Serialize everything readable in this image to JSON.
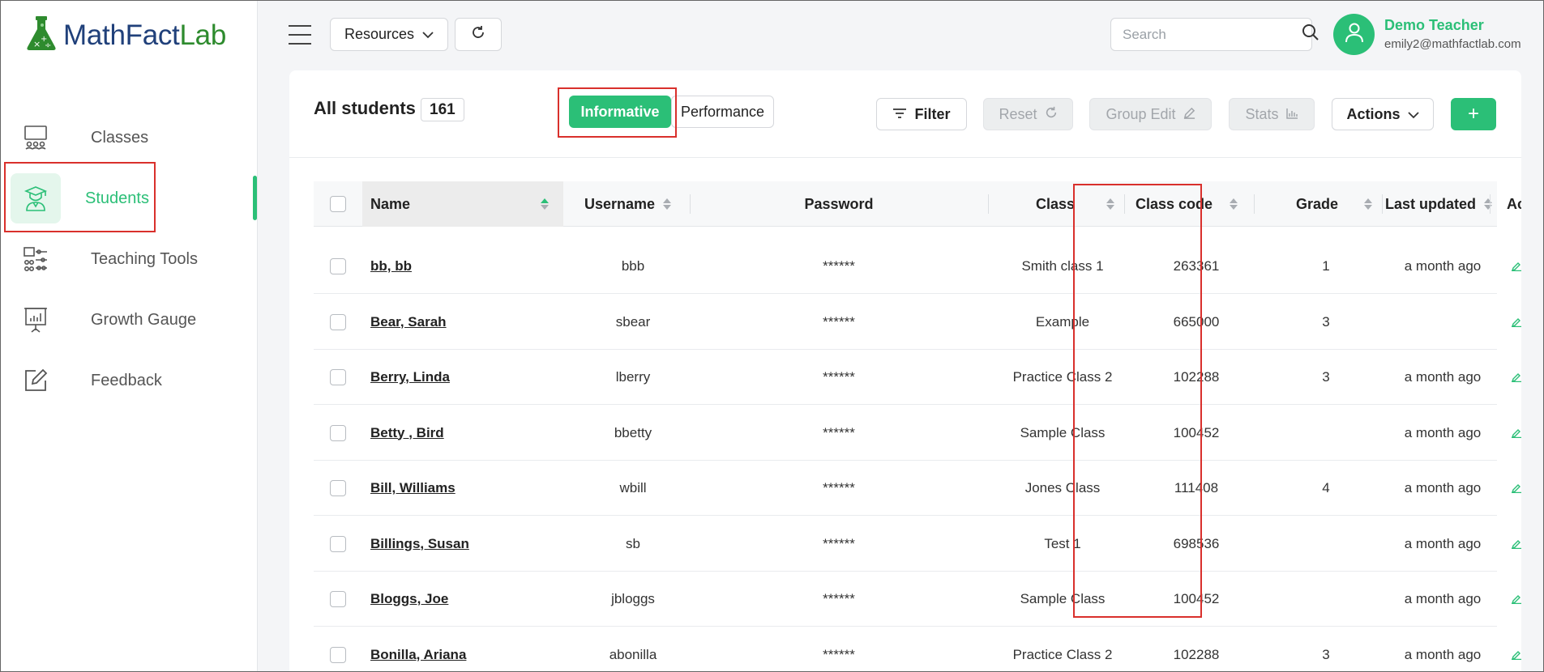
{
  "brand": {
    "name_main": "MathFact",
    "name_accent": "Lab",
    "accent_color": "#2bbf77"
  },
  "sidebar": {
    "items": [
      {
        "label": "Classes",
        "icon": "classroom-icon",
        "active": false
      },
      {
        "label": "Students",
        "icon": "student-icon",
        "active": true
      },
      {
        "label": "Teaching Tools",
        "icon": "abacus-icon",
        "active": false
      },
      {
        "label": "Growth Gauge",
        "icon": "presentation-chart-icon",
        "active": false
      },
      {
        "label": "Feedback",
        "icon": "edit-note-icon",
        "active": false
      }
    ]
  },
  "header": {
    "resources_label": "Resources",
    "search_placeholder": "Search",
    "user_name": "Demo Teacher",
    "user_email": "emily2@mathfactlab.com"
  },
  "main": {
    "title": "All students",
    "count": "161",
    "tabs": {
      "informative": "Informative",
      "performance": "Performance"
    },
    "toolbar": {
      "filter": "Filter",
      "reset": "Reset",
      "group_edit": "Group Edit",
      "stats": "Stats",
      "actions": "Actions",
      "add": "+"
    },
    "table": {
      "columns": {
        "name": "Name",
        "username": "Username",
        "password": "Password",
        "class": "Class",
        "class_code": "Class code",
        "grade": "Grade",
        "last_updated": "Last updated",
        "actions": "Ac"
      },
      "rows": [
        {
          "name": "bb, bb",
          "username": "bbb",
          "password": "******",
          "class": "Smith class 1",
          "class_code": "263361",
          "grade": "1",
          "last_updated": "a month ago"
        },
        {
          "name": "Bear, Sarah",
          "username": "sbear",
          "password": "******",
          "class": "Example",
          "class_code": "665000",
          "grade": "3",
          "last_updated": ""
        },
        {
          "name": "Berry, Linda",
          "username": "lberry",
          "password": "******",
          "class": "Practice Class 2",
          "class_code": "102288",
          "grade": "3",
          "last_updated": "a month ago"
        },
        {
          "name": "Betty , Bird",
          "username": "bbetty",
          "password": "******",
          "class": "Sample Class",
          "class_code": "100452",
          "grade": "",
          "last_updated": "a month ago"
        },
        {
          "name": "Bill, Williams",
          "username": "wbill",
          "password": "******",
          "class": "Jones Class",
          "class_code": "111408",
          "grade": "4",
          "last_updated": "a month ago"
        },
        {
          "name": "Billings, Susan",
          "username": "sb",
          "password": "******",
          "class": "Test 1",
          "class_code": "698536",
          "grade": "",
          "last_updated": "a month ago"
        },
        {
          "name": "Bloggs, Joe",
          "username": "jbloggs",
          "password": "******",
          "class": "Sample Class",
          "class_code": "100452",
          "grade": "",
          "last_updated": "a month ago"
        },
        {
          "name": "Bonilla, Ariana",
          "username": "abonilla",
          "password": "******",
          "class": "Practice Class 2",
          "class_code": "102288",
          "grade": "3",
          "last_updated": "a month ago"
        }
      ]
    }
  }
}
